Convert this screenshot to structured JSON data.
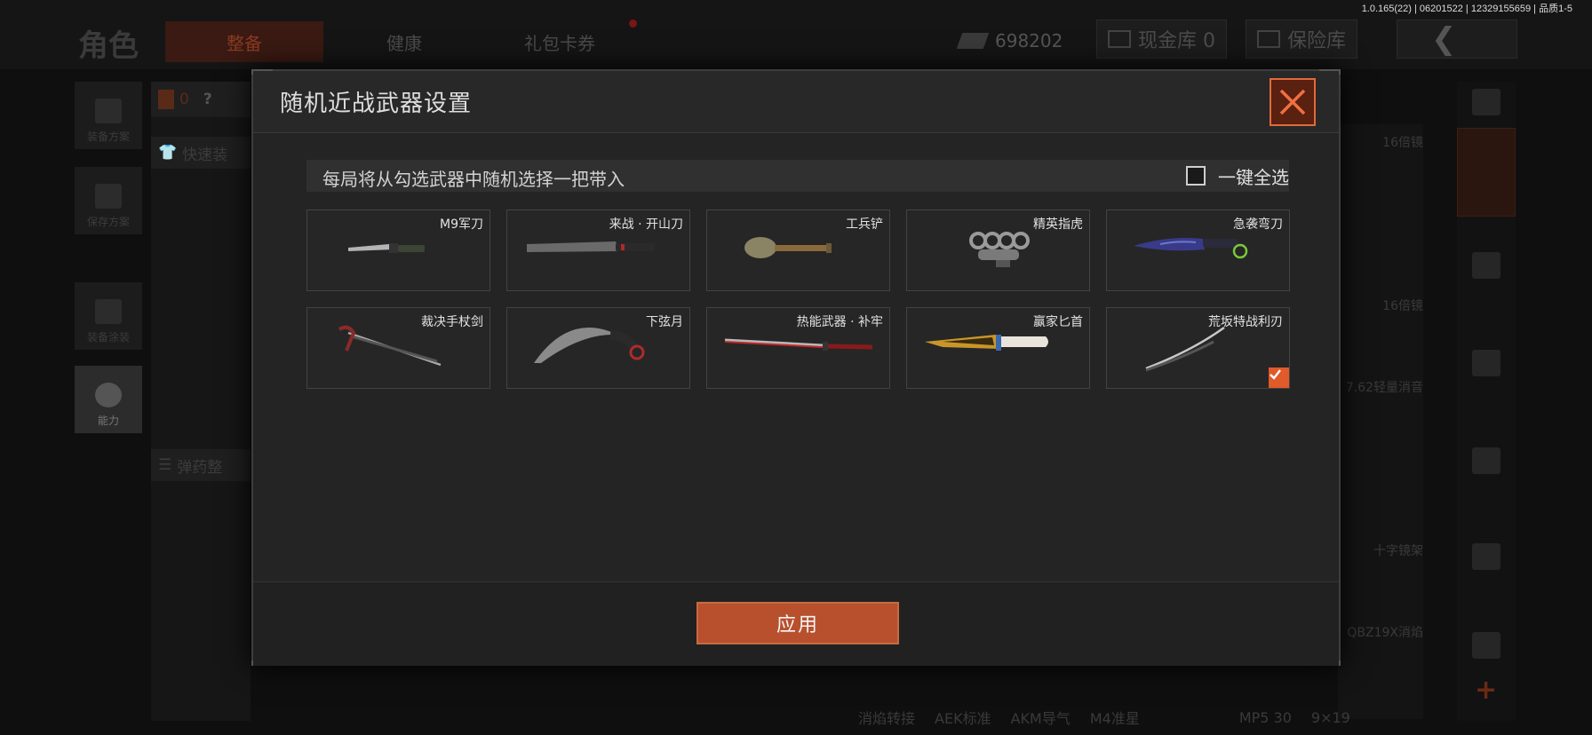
{
  "version_text": "1.0.165(22) | 06201522 | 12329155659 | 品质1-5",
  "page": {
    "title": "角色",
    "tabs": [
      {
        "label": "整备",
        "active": true
      },
      {
        "label": "健康",
        "active": false
      },
      {
        "label": "礼包卡券",
        "active": false
      }
    ],
    "currency_value": "698202",
    "cash_storage_label": "现金库 0",
    "safe_storage_label": "保险库"
  },
  "left_menu": {
    "items": [
      {
        "label": "装备方案",
        "icon": "vest-icon"
      },
      {
        "label": "保存方案",
        "icon": "save-icon"
      },
      {
        "label": "装备涂装",
        "icon": "helmet-icon"
      },
      {
        "label": "能力",
        "icon": "ability-icon"
      }
    ],
    "counter": "0",
    "help": "?",
    "quick_equip": "快速装",
    "ammo": "弹药整"
  },
  "right_panel": {
    "labels": [
      "16倍镜",
      "16倍镜",
      "7.62轻量消音",
      "十字镜架",
      "QBZ19X消焰"
    ]
  },
  "bottom_strip": [
    "消焰转接",
    "AEK标准",
    "AKM导气",
    "M4准星",
    "MP5 30",
    "9×19"
  ],
  "modal": {
    "title": "随机近战武器设置",
    "instruction": "每局将从勾选武器中随机选择一把带入",
    "select_all_label": "一键全选",
    "select_all_checked": false,
    "apply_label": "应用",
    "weapons": [
      {
        "name": "M9军刀",
        "checked": false
      },
      {
        "name": "来战 · 开山刀",
        "checked": false
      },
      {
        "name": "工兵铲",
        "checked": false
      },
      {
        "name": "精英指虎",
        "checked": false
      },
      {
        "name": "急袭弯刀",
        "checked": false
      },
      {
        "name": "裁决手杖剑",
        "checked": false
      },
      {
        "name": "下弦月",
        "checked": false
      },
      {
        "name": "热能武器 · 补牢",
        "checked": false
      },
      {
        "name": "赢家匕首",
        "checked": false
      },
      {
        "name": "荒坂特战利刃",
        "checked": true
      }
    ]
  },
  "colors": {
    "accent": "#e05a2a",
    "apply_button": "#b8502d",
    "modal_bg": "#242424"
  }
}
